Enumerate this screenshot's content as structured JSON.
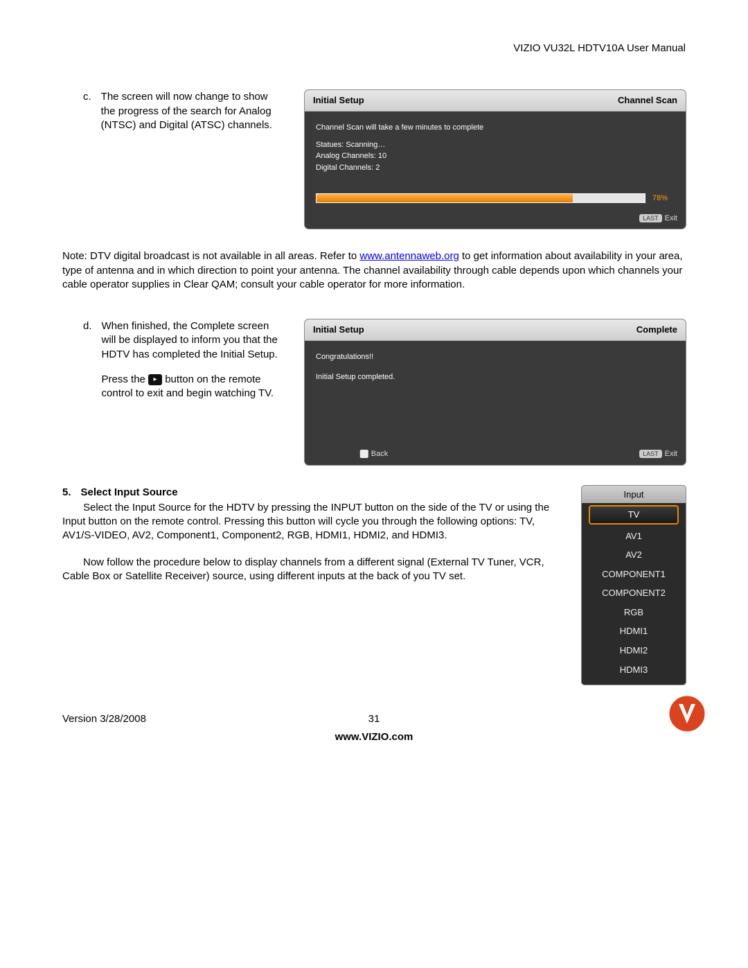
{
  "header": {
    "manual_title": "VIZIO VU32L HDTV10A User Manual"
  },
  "step_c": {
    "letter": "c.",
    "text": "The screen will now change to show the progress of the search for Analog (NTSC) and Digital (ATSC) channels."
  },
  "scan_osd": {
    "title_left": "Initial Setup",
    "title_right": "Channel Scan",
    "line1": "Channel Scan will take a few minutes to complete",
    "status": "Statues: Scanning…",
    "analog": "Analog Channels: 10",
    "digital": "Digital Channels: 2",
    "progress_pct": "78%",
    "progress_fill_width": "78%",
    "footer_last": "LAST",
    "footer_exit": "Exit"
  },
  "note": {
    "prefix": "Note: DTV digital broadcast is not available in all areas.  Refer to ",
    "link_text": "www.antennaweb.org",
    "suffix": " to get information about availability in your area, type of antenna and in which direction to point your antenna.  The channel availability through cable depends upon which channels your cable operator supplies in Clear QAM; consult your cable operator for more information."
  },
  "step_d": {
    "letter": "d.",
    "para1": "When finished, the Complete screen will be displayed to inform you that the HDTV has completed the Initial Setup.",
    "press_prefix": "Press the ",
    "press_suffix": " button on the remote control to exit and begin watching TV.",
    "icon_glyph": "▸"
  },
  "complete_osd": {
    "title_left": "Initial Setup",
    "title_right": "Complete",
    "line1": "Congratulations!!",
    "line2": "Initial Setup completed.",
    "back_label": "Back",
    "footer_last": "LAST",
    "footer_exit": "Exit"
  },
  "section5": {
    "number": "5.",
    "heading": "Select Input Source",
    "para1_indent": "Select the Input Source for the HDTV by pressing the INPUT button on ",
    "para1_rest": "the side of the TV or using the Input button on the remote control.  Pressing this button will cycle you through the following options: TV, AV1/S-VIDEO, AV2, Component1, Component2, RGB, HDMI1, HDMI2, and HDMI3.",
    "para2_indent": "Now follow the procedure below to display channels from a different ",
    "para2_rest": "signal (External TV Tuner, VCR, Cable Box or Satellite Receiver) source, using different inputs at the back of you TV set."
  },
  "input_menu": {
    "header": "Input",
    "items": [
      "TV",
      "AV1",
      "AV2",
      "COMPONENT1",
      "COMPONENT2",
      "RGB",
      "HDMI1",
      "HDMI2",
      "HDMI3"
    ],
    "selected_index": 0
  },
  "footer": {
    "version": "Version 3/28/2008",
    "page": "31",
    "url": "www.VIZIO.com"
  }
}
